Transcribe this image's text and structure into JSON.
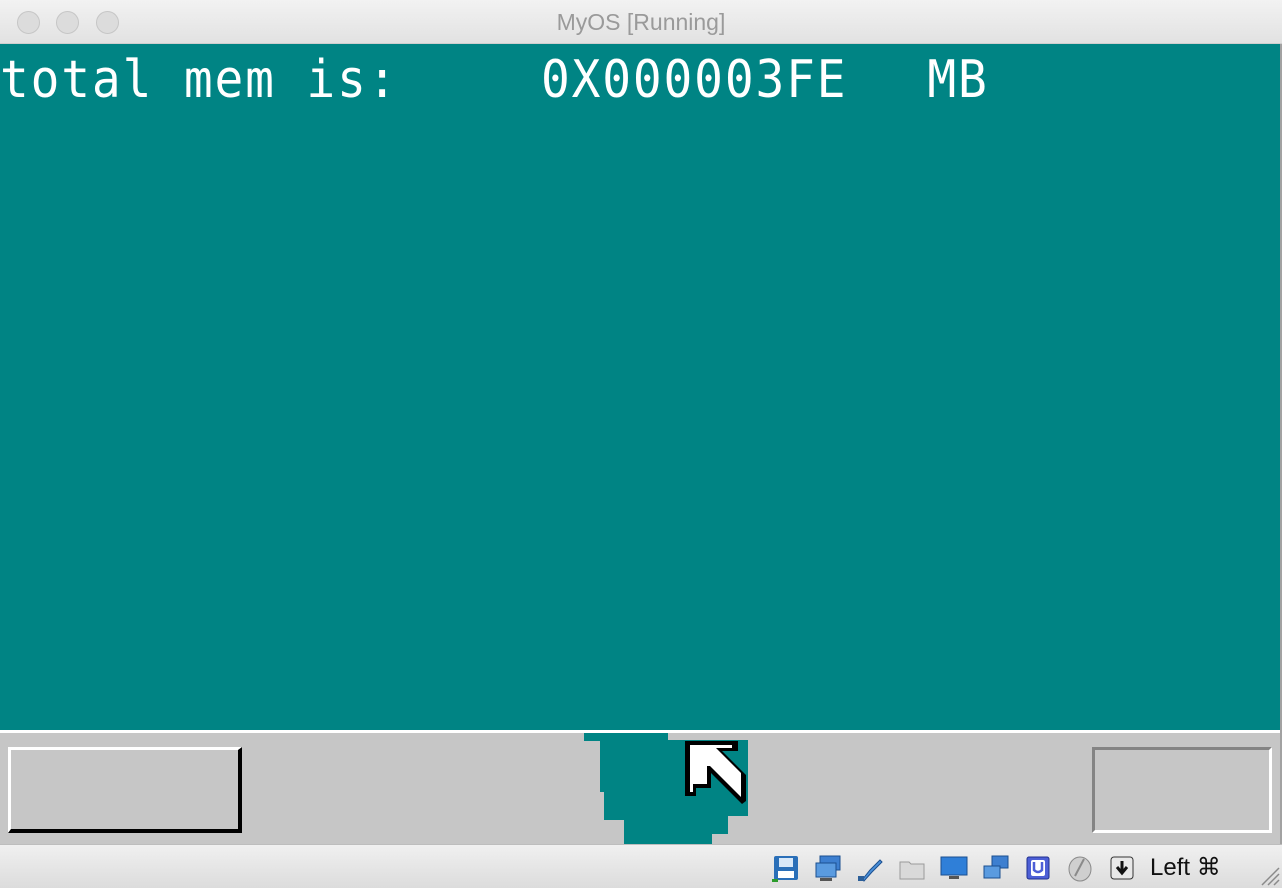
{
  "window": {
    "title": "MyOS [Running]",
    "buttons": [
      "close",
      "minimize",
      "zoom"
    ]
  },
  "guest_screen": {
    "background": "#008484",
    "memory_line": {
      "label": "total mem is:",
      "value": "0X000003FE",
      "unit": "MB"
    },
    "taskbar": {
      "background": "#c6c6c6"
    },
    "cursor": "arrow-pointer"
  },
  "status_bar": {
    "icons": [
      "hard-disk-icon",
      "optical-drive-icon",
      "usb-icon",
      "shared-folders-icon",
      "display-icon",
      "network-icon",
      "video-capture-icon",
      "mouse-integration-icon",
      "keyboard-capture-icon"
    ],
    "host_key": "Left ⌘"
  }
}
